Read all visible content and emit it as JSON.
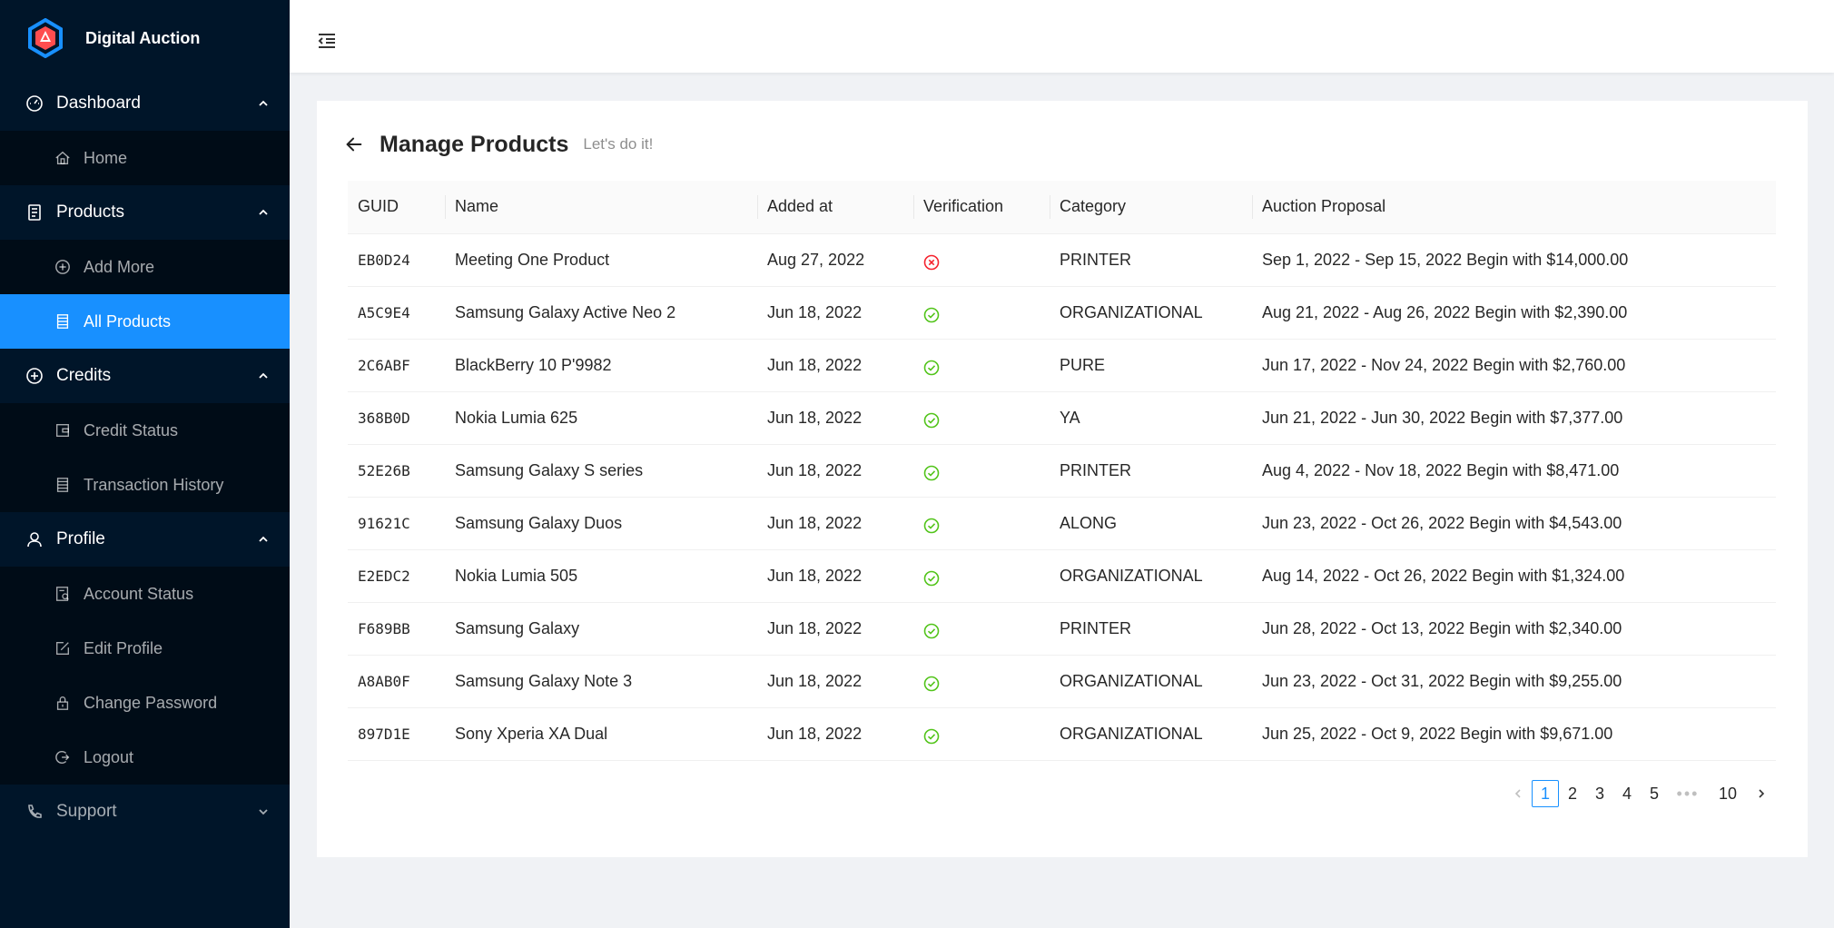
{
  "app": {
    "title": "Digital Auction"
  },
  "sidebar": {
    "groups": [
      {
        "label": "Dashboard",
        "icon": "dashboard-icon",
        "expanded": true,
        "items": [
          {
            "label": "Home",
            "icon": "home-icon"
          }
        ]
      },
      {
        "label": "Products",
        "icon": "products-icon",
        "expanded": true,
        "items": [
          {
            "label": "Add More",
            "icon": "plus-circle-icon"
          },
          {
            "label": "All Products",
            "icon": "list-icon",
            "active": true
          }
        ]
      },
      {
        "label": "Credits",
        "icon": "plus-circle-icon",
        "expanded": true,
        "items": [
          {
            "label": "Credit Status",
            "icon": "wallet-icon"
          },
          {
            "label": "Transaction History",
            "icon": "list-icon"
          }
        ]
      },
      {
        "label": "Profile",
        "icon": "user-icon",
        "expanded": true,
        "items": [
          {
            "label": "Account Status",
            "icon": "account-book-icon"
          },
          {
            "label": "Edit Profile",
            "icon": "edit-icon"
          },
          {
            "label": "Change Password",
            "icon": "lock-icon"
          },
          {
            "label": "Logout",
            "icon": "logout-icon"
          }
        ]
      },
      {
        "label": "Support",
        "icon": "phone-icon",
        "expanded": false,
        "items": []
      }
    ]
  },
  "page": {
    "title": "Manage Products",
    "subtitle": "Let's do it!"
  },
  "table": {
    "columns": [
      "GUID",
      "Name",
      "Added at",
      "Verification",
      "Category",
      "Auction Proposal"
    ],
    "rows": [
      {
        "guid": "EB0D24",
        "name": "Meeting One Product",
        "added": "Aug 27, 2022",
        "verified": false,
        "category": "PRINTER",
        "proposal": "Sep 1, 2022 - Sep 15, 2022 Begin with $14,000.00"
      },
      {
        "guid": "A5C9E4",
        "name": "Samsung Galaxy Active Neo 2",
        "added": "Jun 18, 2022",
        "verified": true,
        "category": "ORGANIZATIONAL",
        "proposal": "Aug 21, 2022 - Aug 26, 2022 Begin with $2,390.00"
      },
      {
        "guid": "2C6ABF",
        "name": "BlackBerry 10 P'9982",
        "added": "Jun 18, 2022",
        "verified": true,
        "category": "PURE",
        "proposal": "Jun 17, 2022 - Nov 24, 2022 Begin with $2,760.00"
      },
      {
        "guid": "368B0D",
        "name": "Nokia Lumia 625",
        "added": "Jun 18, 2022",
        "verified": true,
        "category": "YA",
        "proposal": "Jun 21, 2022 - Jun 30, 2022 Begin with $7,377.00"
      },
      {
        "guid": "52E26B",
        "name": "Samsung Galaxy S series",
        "added": "Jun 18, 2022",
        "verified": true,
        "category": "PRINTER",
        "proposal": "Aug 4, 2022 - Nov 18, 2022 Begin with $8,471.00"
      },
      {
        "guid": "91621C",
        "name": "Samsung Galaxy Duos",
        "added": "Jun 18, 2022",
        "verified": true,
        "category": "ALONG",
        "proposal": "Jun 23, 2022 - Oct 26, 2022 Begin with $4,543.00"
      },
      {
        "guid": "E2EDC2",
        "name": "Nokia Lumia 505",
        "added": "Jun 18, 2022",
        "verified": true,
        "category": "ORGANIZATIONAL",
        "proposal": "Aug 14, 2022 - Oct 26, 2022 Begin with $1,324.00"
      },
      {
        "guid": "F689BB",
        "name": "Samsung Galaxy",
        "added": "Jun 18, 2022",
        "verified": true,
        "category": "PRINTER",
        "proposal": "Jun 28, 2022 - Oct 13, 2022 Begin with $2,340.00"
      },
      {
        "guid": "A8AB0F",
        "name": "Samsung Galaxy Note 3",
        "added": "Jun 18, 2022",
        "verified": true,
        "category": "ORGANIZATIONAL",
        "proposal": "Jun 23, 2022 - Oct 31, 2022 Begin with $9,255.00"
      },
      {
        "guid": "897D1E",
        "name": "Sony Xperia XA Dual",
        "added": "Jun 18, 2022",
        "verified": true,
        "category": "ORGANIZATIONAL",
        "proposal": "Jun 25, 2022 - Oct 9, 2022 Begin with $9,671.00"
      }
    ]
  },
  "pagination": {
    "pages": [
      "1",
      "2",
      "3",
      "4",
      "5"
    ],
    "ellipsis": "•••",
    "last": "10",
    "current": "1"
  },
  "colors": {
    "sidebar_bg": "#001529",
    "submenu_bg": "#000c17",
    "accent": "#1890ff",
    "success": "#52c41a",
    "error": "#f5222d"
  }
}
